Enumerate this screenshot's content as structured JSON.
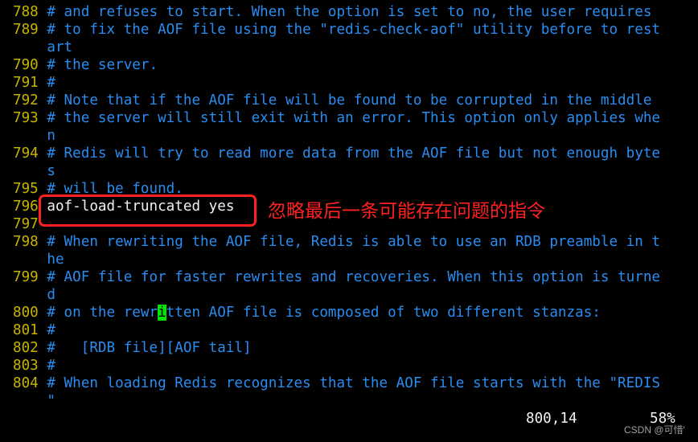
{
  "editor": {
    "lines": [
      {
        "num": "788",
        "text": " # and refuses to start. When the option is set to no, the user requires"
      },
      {
        "num": "789",
        "text": " # to fix the AOF file using the \"redis-check-aof\" utility before to rest"
      },
      {
        "num": "   ",
        "text": " art"
      },
      {
        "num": "790",
        "text": " # the server."
      },
      {
        "num": "791",
        "text": " #"
      },
      {
        "num": "792",
        "text": " # Note that if the AOF file will be found to be corrupted in the middle"
      },
      {
        "num": "793",
        "text": " # the server will still exit with an error. This option only applies whe"
      },
      {
        "num": "   ",
        "text": " n"
      },
      {
        "num": "794",
        "text": " # Redis will try to read more data from the AOF file but not enough byte"
      },
      {
        "num": "   ",
        "text": " s"
      },
      {
        "num": "795",
        "text": " # will be found."
      },
      {
        "num": "796",
        "text": " aof-load-truncated yes",
        "kind": "code"
      },
      {
        "num": "797",
        "text": ""
      },
      {
        "num": "798",
        "text": " # When rewriting the AOF file, Redis is able to use an RDB preamble in t"
      },
      {
        "num": "   ",
        "text": " he"
      },
      {
        "num": "799",
        "text": " # AOF file for faster rewrites and recoveries. When this option is turne"
      },
      {
        "num": "   ",
        "text": " d"
      },
      {
        "num": "800",
        "text": " # on the rewr",
        "cursor": "i",
        "after": "tten AOF file is composed of two different stanzas:"
      },
      {
        "num": "801",
        "text": " #"
      },
      {
        "num": "802",
        "text": " #   [RDB file][AOF tail]"
      },
      {
        "num": "803",
        "text": " #"
      },
      {
        "num": "804",
        "text": " # When loading Redis recognizes that the AOF file starts with the \"REDIS"
      },
      {
        "num": "   ",
        "text": " \""
      }
    ],
    "status": {
      "position": "800,14",
      "percent": "58%"
    },
    "colors": {
      "line_number": "#c8b400",
      "comment": "#2a8cf0",
      "cursor": "#00e600",
      "annotation": "#ff2020"
    }
  },
  "annotation": {
    "text": "忽略最后一条可能存在问题的指令"
  },
  "watermark": "CSDN @可惜'"
}
